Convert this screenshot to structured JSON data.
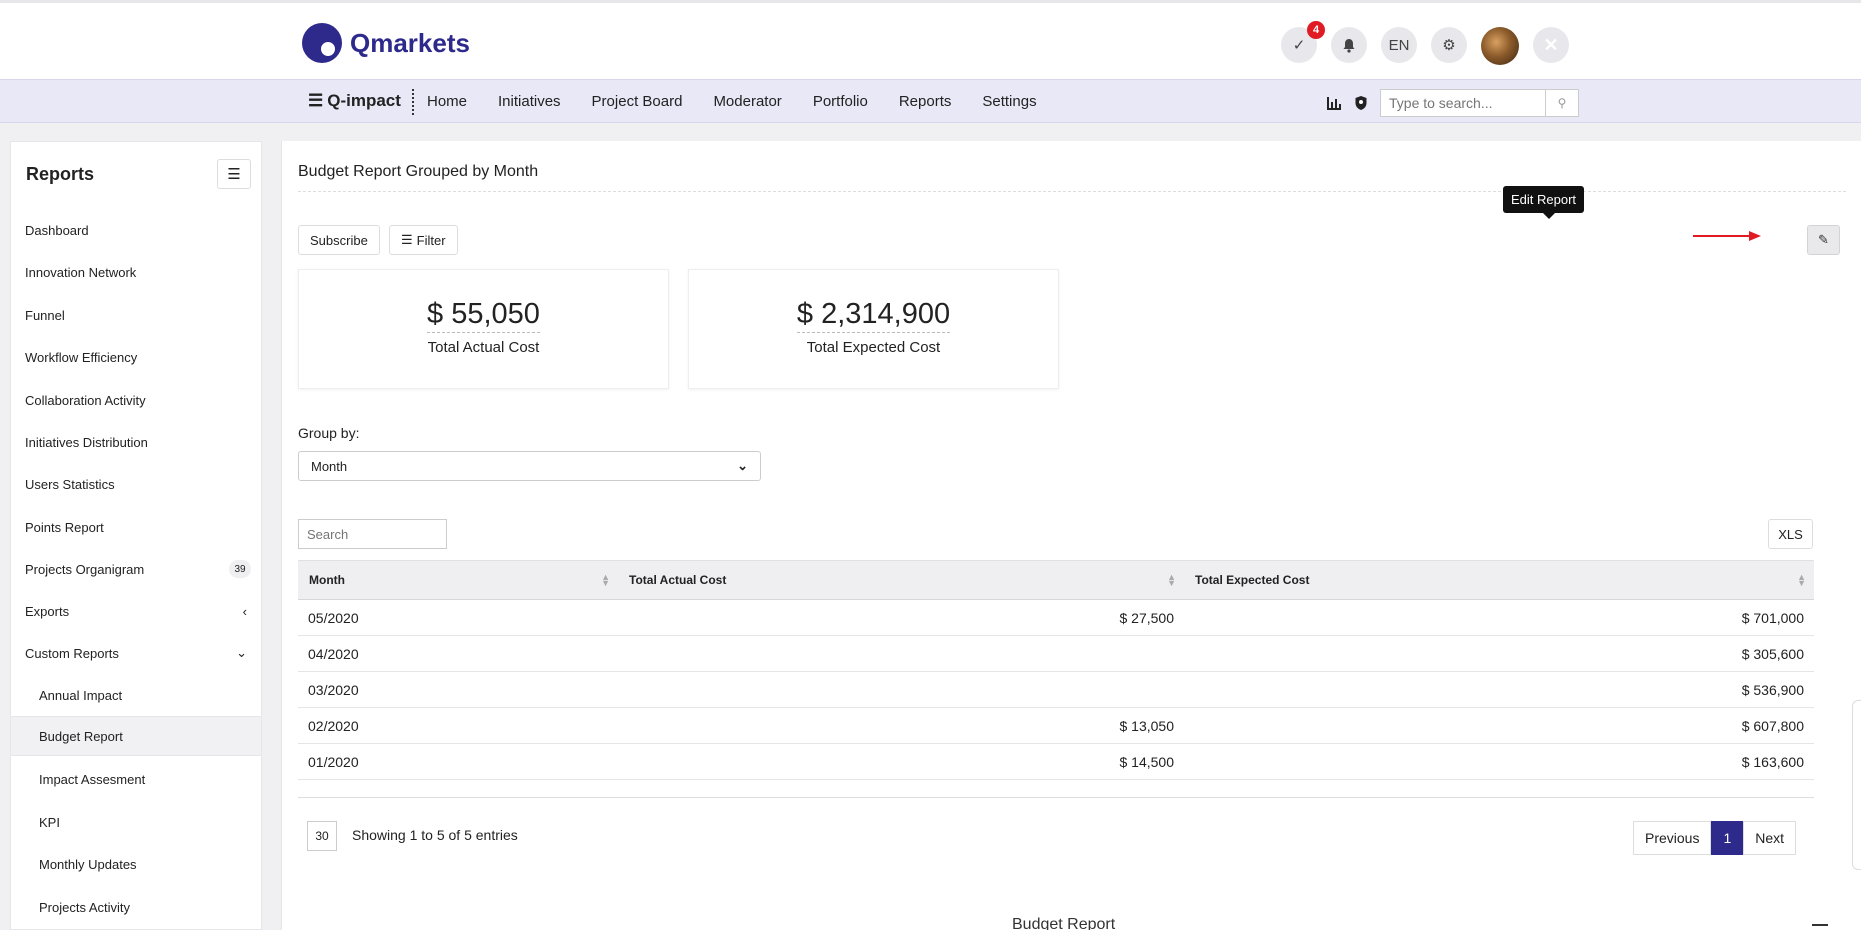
{
  "header": {
    "logo_text": "Qmarkets",
    "notification_badge": "4",
    "language": "EN"
  },
  "nav": {
    "brand": "Q-impact",
    "items": [
      {
        "label": "Home"
      },
      {
        "label": "Initiatives"
      },
      {
        "label": "Project Board"
      },
      {
        "label": "Moderator"
      },
      {
        "label": "Portfolio"
      },
      {
        "label": "Reports"
      },
      {
        "label": "Settings"
      }
    ],
    "search_placeholder": "Type to search..."
  },
  "sidebar": {
    "title": "Reports",
    "items": [
      {
        "label": "Dashboard"
      },
      {
        "label": "Innovation Network"
      },
      {
        "label": "Funnel"
      },
      {
        "label": "Workflow Efficiency"
      },
      {
        "label": "Collaboration Activity"
      },
      {
        "label": "Initiatives Distribution"
      },
      {
        "label": "Users Statistics"
      },
      {
        "label": "Points Report"
      },
      {
        "label": "Projects Organigram",
        "count": "39"
      },
      {
        "label": "Exports"
      },
      {
        "label": "Custom Reports"
      },
      {
        "label": "Annual Impact"
      },
      {
        "label": "Budget Report"
      },
      {
        "label": "Impact Assesment"
      },
      {
        "label": "KPI"
      },
      {
        "label": "Monthly Updates"
      },
      {
        "label": "Projects Activity"
      }
    ]
  },
  "main": {
    "title": "Budget Report Grouped by Month",
    "subscribe_label": "Subscribe",
    "filter_label": "Filter",
    "tooltip": "Edit Report",
    "kpis": [
      {
        "value": "$ 55,050",
        "label": "Total Actual Cost"
      },
      {
        "value": "$ 2,314,900",
        "label": "Total Expected Cost"
      }
    ],
    "group_by_label": "Group by:",
    "group_by_value": "Month",
    "table_search_placeholder": "Search",
    "xls_label": "XLS",
    "columns": [
      "Month",
      "Total Actual Cost",
      "Total Expected Cost"
    ],
    "rows": [
      {
        "month": "05/2020",
        "actual": "$ 27,500",
        "expected": "$ 701,000"
      },
      {
        "month": "04/2020",
        "actual": "",
        "expected": "$ 305,600"
      },
      {
        "month": "03/2020",
        "actual": "",
        "expected": "$ 536,900"
      },
      {
        "month": "02/2020",
        "actual": "$ 13,050",
        "expected": "$ 607,800"
      },
      {
        "month": "01/2020",
        "actual": "$ 14,500",
        "expected": "$ 163,600"
      }
    ],
    "page_length": "30",
    "info": "Showing 1 to 5 of 5 entries",
    "pager": {
      "previous": "Previous",
      "current": "1",
      "next": "Next"
    },
    "bottom_section_title": "Budget Report"
  }
}
